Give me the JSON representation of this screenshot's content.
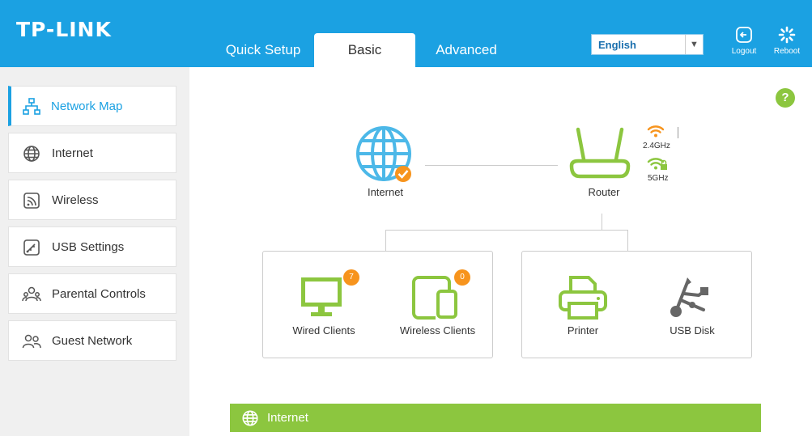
{
  "header": {
    "logo": "TP-LINK",
    "tabs": [
      {
        "label": "Quick Setup"
      },
      {
        "label": "Basic"
      },
      {
        "label": "Advanced"
      }
    ],
    "language": "English",
    "logout_label": "Logout",
    "reboot_label": "Reboot",
    "brand_color": "#1ba1e2"
  },
  "sidebar": {
    "items": [
      {
        "label": "Network Map",
        "icon": "network-map-icon"
      },
      {
        "label": "Internet",
        "icon": "globe-icon"
      },
      {
        "label": "Wireless",
        "icon": "wireless-icon"
      },
      {
        "label": "USB Settings",
        "icon": "usb-settings-icon"
      },
      {
        "label": "Parental Controls",
        "icon": "parental-controls-icon"
      },
      {
        "label": "Guest Network",
        "icon": "guest-network-icon"
      }
    ]
  },
  "main": {
    "help": "?",
    "internet_label": "Internet",
    "router_label": "Router",
    "band_24": "2.4GHz",
    "band_5": "5GHz",
    "wired_clients_label": "Wired Clients",
    "wired_clients_count": "7",
    "wireless_clients_label": "Wireless Clients",
    "wireless_clients_count": "0",
    "printer_label": "Printer",
    "usb_disk_label": "USB Disk",
    "section_bar_label": "Internet",
    "accent_green": "#8cc63f",
    "accent_orange": "#f7941d"
  }
}
